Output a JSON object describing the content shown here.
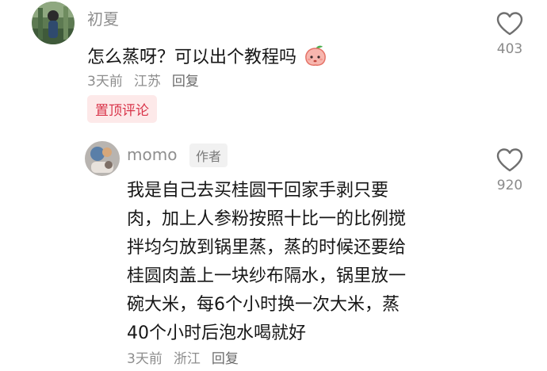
{
  "comment1": {
    "username": "初夏",
    "text": "怎么蒸呀？可以出个教程吗",
    "emoji_icon": "peach-emoji-icon",
    "time": "3天前",
    "location": "江苏",
    "reply_label": "回复",
    "likes": "403",
    "pinned_label": "置顶评论"
  },
  "comment2": {
    "username": "momo",
    "author_badge": "作者",
    "lines": [
      "我是自己去买桂圆干回家手剥只要",
      "肉，加上人参粉按照十比一的比例搅",
      "拌均匀放到锅里蒸，蒸的时候还要给",
      "桂圆肉盖上一块纱布隔水，锅里放一",
      "碗大米，每6个小时换一次大米，蒸",
      "40个小时后泡水喝就好"
    ],
    "time": "3天前",
    "location": "浙江",
    "reply_label": "回复",
    "likes": "920"
  },
  "colors": {
    "pinned_text": "#d9354a",
    "pinned_bg": "#fde9e9",
    "secondary_text": "#8d8d8d"
  }
}
